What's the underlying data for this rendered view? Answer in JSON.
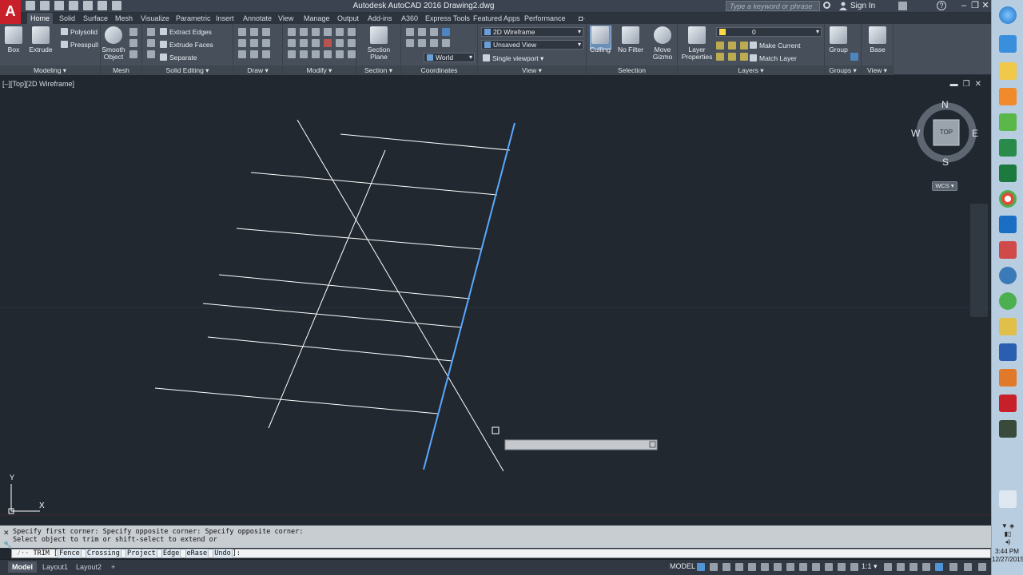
{
  "window": {
    "title": "Autodesk AutoCAD 2016   Drawing2.dwg",
    "logo": "A",
    "search_placeholder": "Type a keyword or phrase",
    "sign_in": "Sign In",
    "help": "?",
    "minimize": "–",
    "restore": "❐",
    "close": "✕"
  },
  "ribbon_tabs": [
    "Home",
    "Solid",
    "Surface",
    "Mesh",
    "Visualize",
    "Parametric",
    "Insert",
    "Annotate",
    "View",
    "Manage",
    "Output",
    "Add-ins",
    "A360",
    "Express Tools",
    "Featured Apps",
    "Performance"
  ],
  "ribbon": {
    "modeling": {
      "label": "Modeling ▾",
      "box": "Box",
      "extrude": "Extrude",
      "polysolid": "Polysolid",
      "presspull": "Presspull"
    },
    "mesh": {
      "label": "Mesh",
      "smooth_object": "Smooth Object"
    },
    "solid_editing": {
      "label": "Solid Editing ▾",
      "extract_edges": "Extract Edges",
      "extrude_faces": "Extrude Faces",
      "separate": "Separate"
    },
    "draw": {
      "label": "Draw ▾"
    },
    "modify": {
      "label": "Modify ▾"
    },
    "section": {
      "label": "Section ▾",
      "section_plane": "Section Plane"
    },
    "coordinates": {
      "label": "Coordinates",
      "world": "World"
    },
    "view": {
      "label": "View ▾",
      "visual_style": "2D Wireframe",
      "named_view": "Unsaved View",
      "viewport": "Single viewport ▾"
    },
    "selection": {
      "label": "Selection",
      "culling": "Culling",
      "no_filter": "No Filter",
      "move_gizmo": "Move Gizmo"
    },
    "layers": {
      "label": "Layers ▾",
      "layer_properties": "Layer Properties",
      "layer_name": "0",
      "make_current": "Make Current",
      "match_layer": "Match Layer"
    },
    "groups": {
      "label": "Groups ▾",
      "group": "Group"
    },
    "view2": {
      "label": "View ▾",
      "base": "Base"
    }
  },
  "viewport": {
    "label": "[–][Top][2D Wireframe]",
    "controls": "▬❐✕",
    "viewcube": {
      "n": "N",
      "s": "S",
      "e": "E",
      "w": "W",
      "face": "TOP"
    },
    "wcs": "WCS ▾",
    "ucs_x": "X",
    "ucs_y": "Y"
  },
  "command": {
    "history_1": "Specify first corner: Specify opposite corner: Specify opposite corner:",
    "history_2": "Select object to trim or shift-select to extend or",
    "prompt_icon": "⁄·· ",
    "command_name": "TRIM [",
    "options": [
      "Fence",
      "Crossing",
      "Project",
      "Edge",
      "eRase",
      "Undo"
    ],
    "suffix": "]:"
  },
  "layout_tabs": [
    "Model",
    "Layout1",
    "Layout2",
    "+"
  ],
  "status": {
    "model": "MODEL",
    "scale": "1:1 ▾"
  },
  "clock": {
    "time": "3:44 PM",
    "date": "12/27/2015"
  },
  "colors": {
    "canvas": "#212830",
    "selected_line": "#5aa8ff",
    "line": "#ffffff",
    "accent": "#c8202a"
  }
}
